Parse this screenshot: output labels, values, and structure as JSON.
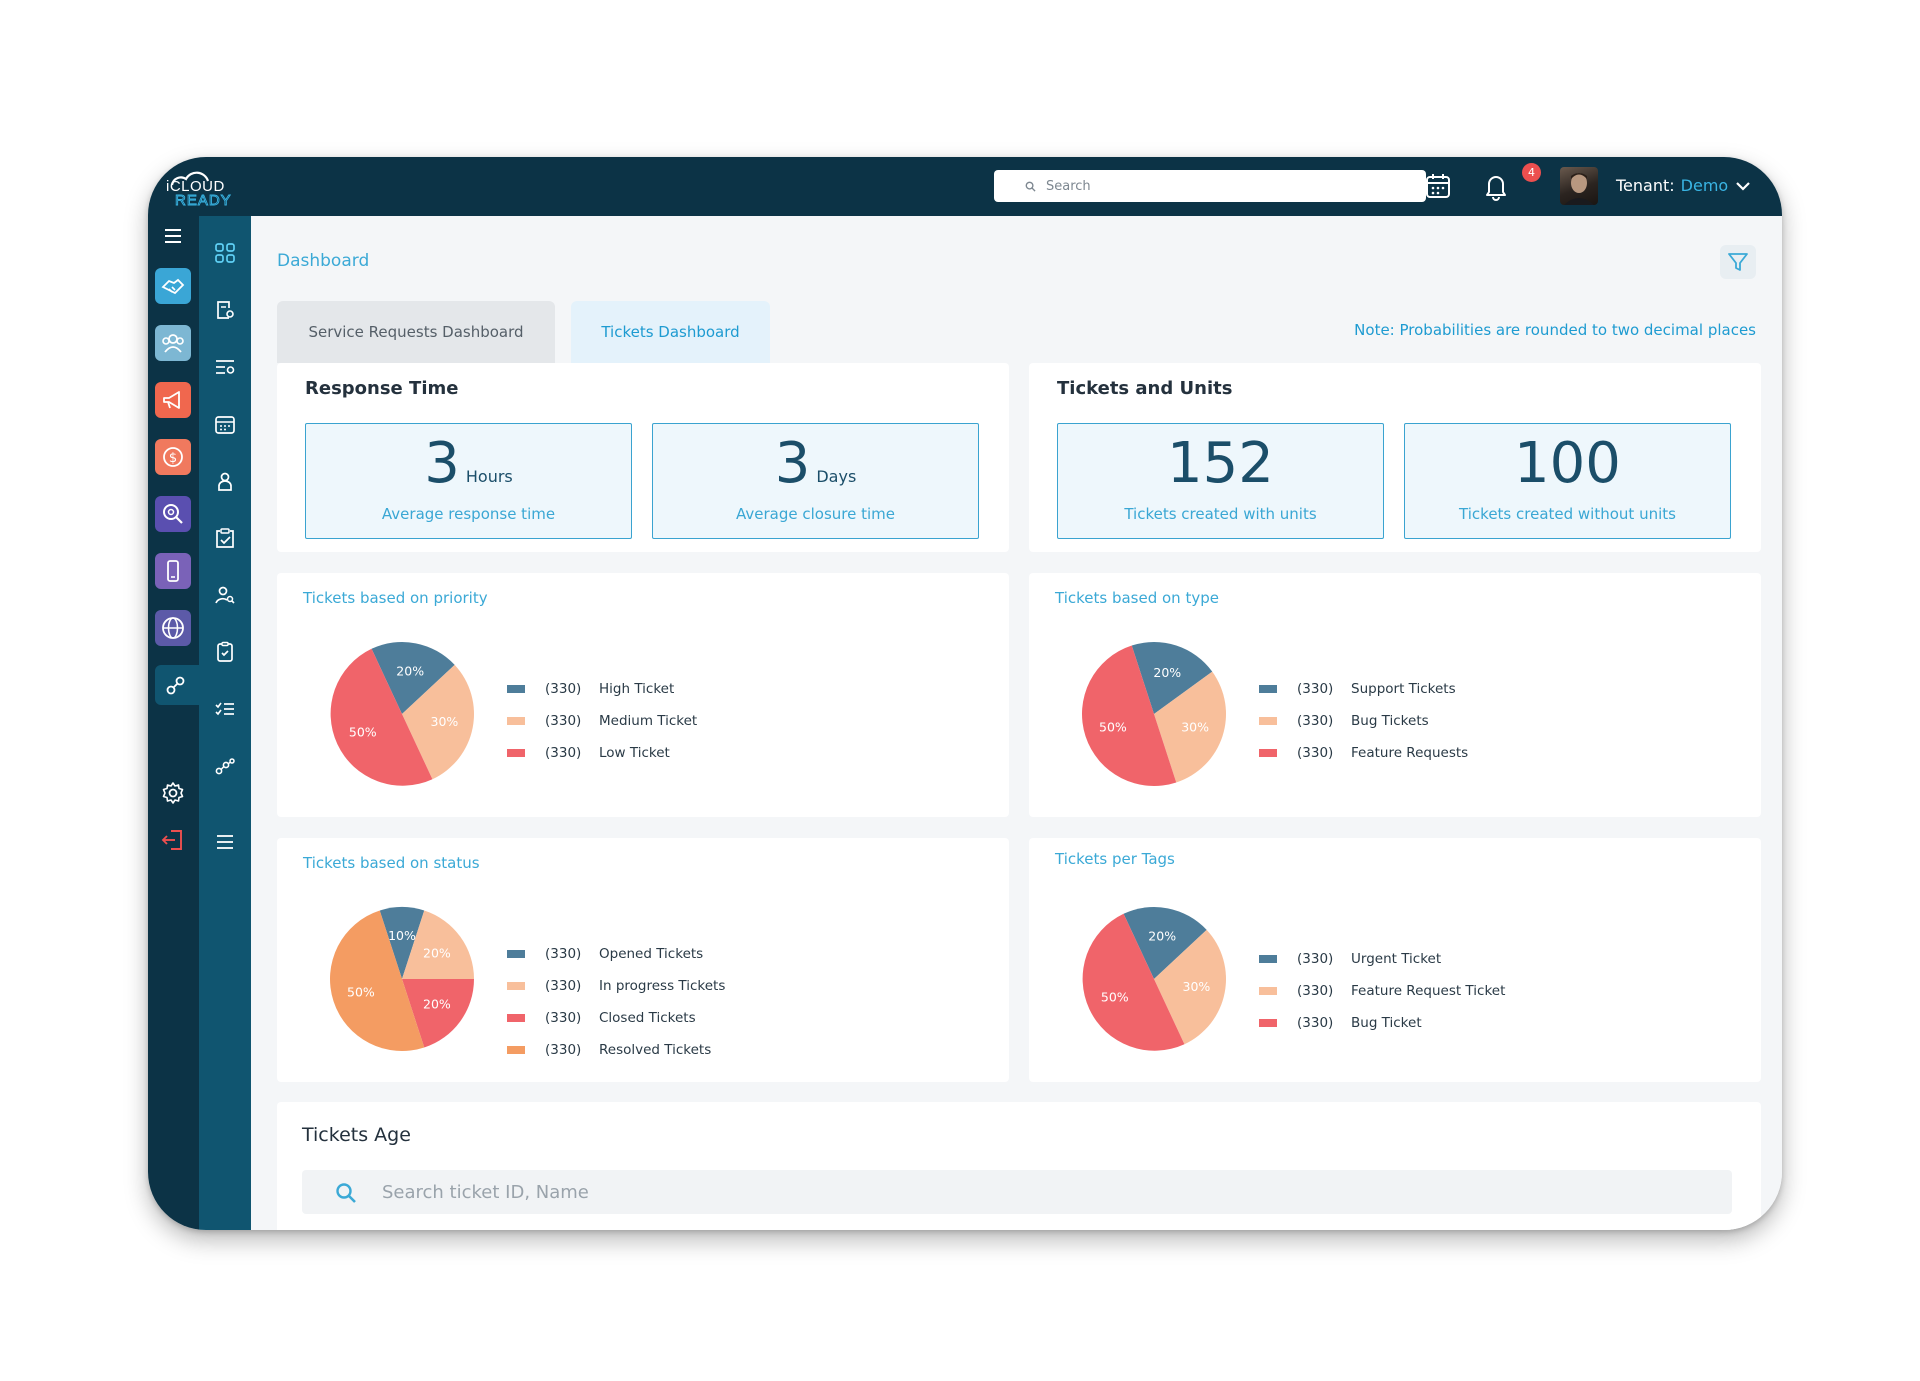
{
  "brand": {
    "name": "iCLOUD READY"
  },
  "topbar": {
    "search_placeholder": "Search",
    "notifications_count": "4",
    "tenant_label": "Tenant:",
    "tenant_value": "Demo"
  },
  "breadcrumb": "Dashboard",
  "tabs": [
    {
      "label": "Service Requests Dashboard",
      "active": false
    },
    {
      "label": "Tickets Dashboard",
      "active": true
    }
  ],
  "note": "Note: Probabilities are rounded to two decimal places",
  "response_time": {
    "title": "Response Time",
    "stats": [
      {
        "value": "3",
        "unit": "Hours",
        "caption": "Average response time"
      },
      {
        "value": "3",
        "unit": "Days",
        "caption": "Average closure time"
      }
    ]
  },
  "tickets_units": {
    "title": "Tickets and Units",
    "stats": [
      {
        "value": "152",
        "caption": "Tickets created with units"
      },
      {
        "value": "100",
        "caption": "Tickets created without units"
      }
    ]
  },
  "colors": {
    "navy": "#0c3346",
    "teal": "#105570",
    "blue_accent": "#3ba9d6",
    "slate": "#4e7d9a",
    "peach": "#f8bf9b",
    "coral": "#f0646a",
    "orange": "#f49c62"
  },
  "chart_data": [
    {
      "type": "pie",
      "title": "Tickets based on priority",
      "slices": [
        {
          "label": "High Ticket",
          "count": "(330)",
          "value": 20,
          "percent_label": "20%",
          "color": "#4e7d9a"
        },
        {
          "label": "Medium Ticket",
          "count": "(330)",
          "value": 30,
          "percent_label": "30%",
          "color": "#f8bf9b"
        },
        {
          "label": "Low Ticket",
          "count": "(330)",
          "value": 50,
          "percent_label": "50%",
          "color": "#f0646a"
        }
      ]
    },
    {
      "type": "pie",
      "title": "Tickets based on type",
      "slices": [
        {
          "label": "Support Tickets",
          "count": "(330)",
          "value": 20,
          "percent_label": "20%",
          "color": "#4e7d9a"
        },
        {
          "label": "Bug Tickets",
          "count": "(330)",
          "value": 30,
          "percent_label": "30%",
          "color": "#f8bf9b"
        },
        {
          "label": "Feature Requests",
          "count": "(330)",
          "value": 50,
          "percent_label": "50%",
          "color": "#f0646a"
        }
      ]
    },
    {
      "type": "pie",
      "title": "Tickets based on status",
      "slices": [
        {
          "label": "Opened Tickets",
          "count": "(330)",
          "value": 10,
          "percent_label": "10%",
          "color": "#4e7d9a"
        },
        {
          "label": "In progress Tickets",
          "count": "(330)",
          "value": 20,
          "percent_label": "20%",
          "color": "#f8bf9b"
        },
        {
          "label": "Closed Tickets",
          "count": "(330)",
          "value": 20,
          "percent_label": "20%",
          "color": "#f0646a"
        },
        {
          "label": "Resolved Tickets",
          "count": "(330)",
          "value": 50,
          "percent_label": "50%",
          "color": "#f49c62"
        }
      ]
    },
    {
      "type": "pie",
      "title": "Tickets per Tags",
      "slices": [
        {
          "label": "Urgent Ticket",
          "count": "(330)",
          "value": 20,
          "percent_label": "20%",
          "color": "#4e7d9a"
        },
        {
          "label": "Feature Request Ticket",
          "count": "(330)",
          "value": 30,
          "percent_label": "30%",
          "color": "#f8bf9b"
        },
        {
          "label": "Bug Ticket",
          "count": "(330)",
          "value": 50,
          "percent_label": "50%",
          "color": "#f0646a"
        }
      ]
    }
  ],
  "tickets_age": {
    "title": "Tickets Age",
    "search_placeholder": "Search ticket ID, Name"
  }
}
